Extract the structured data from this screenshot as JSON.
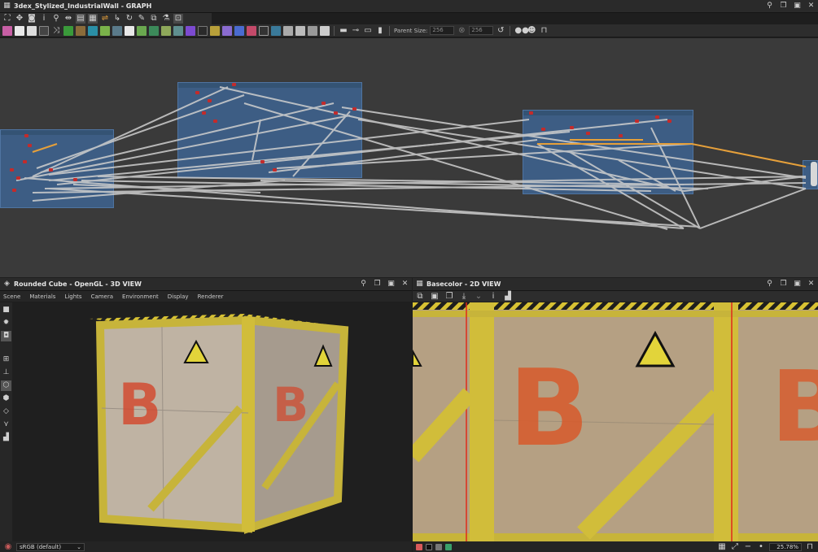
{
  "graph_window": {
    "title": "3dex_Stylized_IndustrialWall - GRAPH",
    "parent_size_label": "Parent Size:",
    "parent_size_value": "256",
    "parent_size_value2": "256"
  },
  "view3d": {
    "title": "Rounded Cube - OpenGL - 3D VIEW",
    "menu": [
      "Scene",
      "Materials",
      "Lights",
      "Camera",
      "Environment",
      "Display",
      "Renderer"
    ],
    "colorspace": "sRGB (default)"
  },
  "view2d": {
    "title": "Basecolor - 2D VIEW",
    "zoom": "25.78%"
  },
  "decal_letter": "B",
  "colors": {
    "accent_orange": "#e6a03a",
    "frame_blue": "#3d5d84",
    "node_red": "#c32b2b",
    "hazard_yellow": "#d8c233"
  }
}
